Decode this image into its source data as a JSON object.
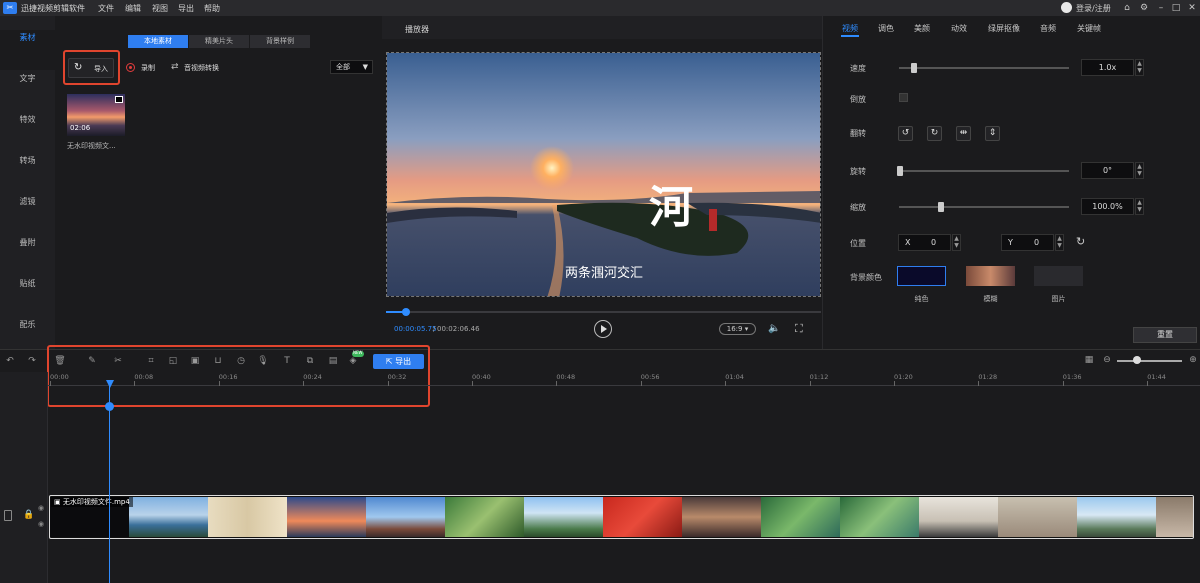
{
  "app": {
    "title": "迅捷视频剪辑软件",
    "menu": [
      "文件",
      "编辑",
      "视图",
      "导出",
      "帮助"
    ],
    "login": "登录/注册"
  },
  "left_nav": {
    "items": [
      {
        "label": "素材",
        "active": true
      },
      {
        "label": "文字"
      },
      {
        "label": "特效"
      },
      {
        "label": "转场"
      },
      {
        "label": "滤镜"
      },
      {
        "label": "叠附"
      },
      {
        "label": "贴纸"
      },
      {
        "label": "配乐"
      }
    ]
  },
  "media": {
    "subtabs": [
      "本地素材",
      "精美片头",
      "背景样例"
    ],
    "import_label": "导入",
    "record_label": "录制",
    "convert_label": "音视频转换",
    "filter_value": "全部",
    "thumbnail": {
      "duration": "02:06",
      "name": "无水印视频文..."
    }
  },
  "player": {
    "title": "播放器",
    "overlay_char": "河",
    "caption": "两条涠河交汇",
    "time_current": "00:00:05.75",
    "time_total": "00:02:06.46",
    "aspect_ratio": "16:9",
    "progress_fraction": 0.045
  },
  "properties": {
    "tabs": [
      "视频",
      "调色",
      "美颜",
      "动效",
      "绿屏抠像",
      "音频",
      "关键帧"
    ],
    "speed_label": "速度",
    "speed_value": "1.0x",
    "reverse_label": "倒放",
    "flip_label": "翻转",
    "rotate_label": "旋转",
    "rotate_value": "0°",
    "scale_label": "缩放",
    "scale_value": "100.0%",
    "position_label": "位置",
    "x_label": "X",
    "x_value": "0",
    "y_label": "Y",
    "y_value": "0",
    "bg_color_label": "背景颜色",
    "bg_options": [
      "纯色",
      "模糊",
      "图片"
    ],
    "reset_label": "重置",
    "colors": {
      "accent": "#2f8cff",
      "bg_solid": "#0a0a2a"
    }
  },
  "timeline": {
    "export_label": "导出",
    "new_badge": "NEW",
    "ruler_ticks": [
      "00:00",
      "00:08",
      "00:16",
      "00:24",
      "00:32",
      "00:40",
      "00:48",
      "00:56",
      "01:04",
      "01:12",
      "01:20",
      "01:28",
      "01:36",
      "01:44"
    ],
    "clip_name": "无水印视频文件.mp4"
  }
}
